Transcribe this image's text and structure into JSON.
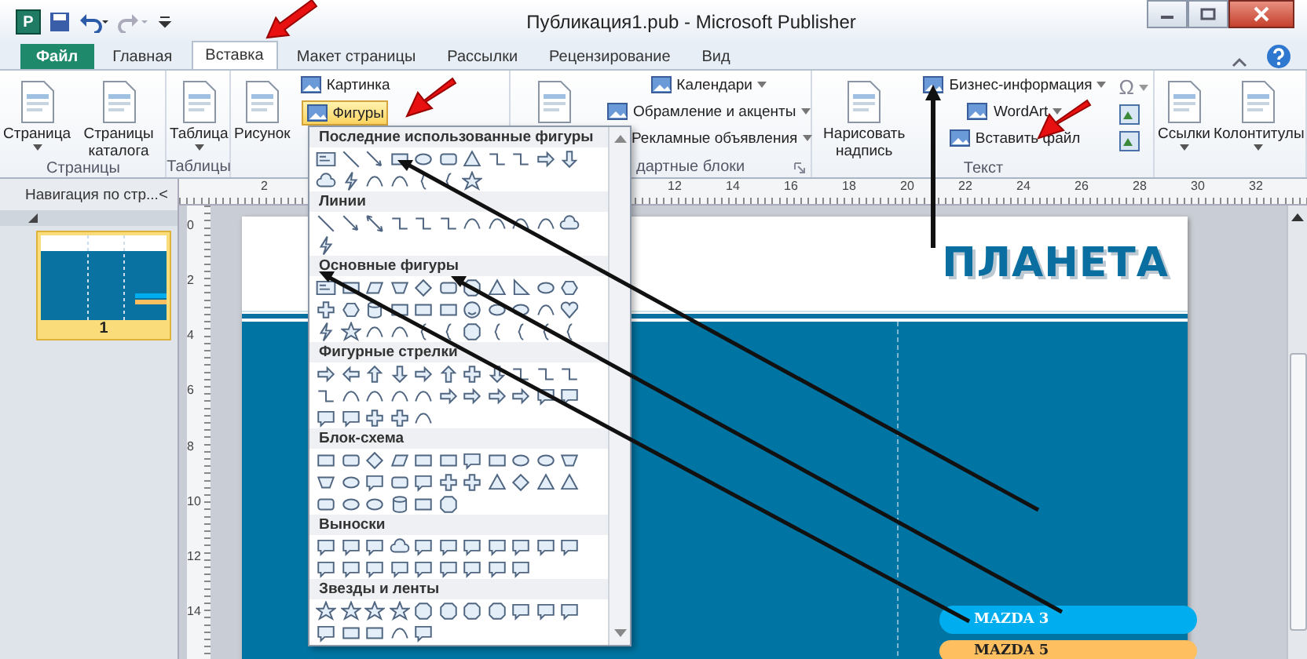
{
  "window": {
    "title": "Публикация1.pub - Microsoft Publisher",
    "app_logo": "P"
  },
  "tabs": [
    {
      "label": "Файл",
      "kind": "file",
      "selected": false
    },
    {
      "label": "Главная",
      "kind": "tab",
      "selected": false
    },
    {
      "label": "Вставка",
      "kind": "tab",
      "selected": true
    },
    {
      "label": "Макет страницы",
      "kind": "tab",
      "selected": false
    },
    {
      "label": "Рассылки",
      "kind": "tab",
      "selected": false
    },
    {
      "label": "Рецензирование",
      "kind": "tab",
      "selected": false
    },
    {
      "label": "Вид",
      "kind": "tab",
      "selected": false
    }
  ],
  "ribbon": {
    "groups": [
      {
        "label": "Страницы",
        "items": [
          {
            "kind": "large",
            "label": "Страница",
            "dropdown": true
          },
          {
            "kind": "large",
            "label": "Страницы каталога"
          }
        ]
      },
      {
        "label": "Таблицы",
        "items": [
          {
            "kind": "large",
            "label": "Таблица",
            "dropdown": true
          }
        ]
      },
      {
        "items": [
          {
            "kind": "large",
            "label": "Рисунок"
          },
          {
            "kind": "small",
            "label": "Картинка",
            "active": false
          },
          {
            "kind": "small",
            "label": "Фигуры",
            "active": true
          }
        ]
      },
      {
        "label": "дартные блоки",
        "launcher": true,
        "items": [
          {
            "kind": "large"
          },
          {
            "kind": "small",
            "label": "Календари",
            "dropdown": true,
            "active": false
          },
          {
            "kind": "small",
            "label": "Обрамление и акценты",
            "dropdown": true,
            "active": false
          },
          {
            "kind": "small",
            "label": "Рекламные объявления",
            "dropdown": true,
            "active": false
          }
        ]
      },
      {
        "label": "Текст",
        "items": [
          {
            "kind": "large",
            "label": "Нарисовать надпись"
          },
          {
            "kind": "small",
            "label": "Бизнес-информация",
            "dropdown": true,
            "active": false
          },
          {
            "kind": "small",
            "label": "WordArt",
            "dropdown": true,
            "active": false
          },
          {
            "kind": "small",
            "label": "Вставить файл",
            "active": false
          },
          {
            "kind": "icon",
            "label": "Ω",
            "dropdown": true
          },
          {
            "kind": "icon"
          },
          {
            "kind": "icon"
          }
        ]
      },
      {
        "items": [
          {
            "kind": "large",
            "label": "Ссылки",
            "dropdown": true
          },
          {
            "kind": "large",
            "label": "Колонтитулы",
            "dropdown": true
          }
        ]
      }
    ]
  },
  "shapes_menu": {
    "sections": [
      {
        "title": "Последние использованные фигуры"
      },
      {
        "title": "Линии"
      },
      {
        "title": "Основные фигуры"
      },
      {
        "title": "Фигурные стрелки"
      },
      {
        "title": "Блок-схема"
      },
      {
        "title": "Выноски"
      },
      {
        "title": "Звезды и ленты"
      }
    ]
  },
  "navigation": {
    "title": "Навигация по стр...",
    "collapse": "<",
    "pages": [
      {
        "label": "1",
        "selected": true
      }
    ]
  },
  "rulers": {
    "horizontal": [
      "2",
      "12",
      "14",
      "16",
      "18",
      "20",
      "22",
      "24",
      "26",
      "28",
      "30",
      "32"
    ],
    "vertical": [
      "0",
      "2",
      "4",
      "6",
      "8",
      "10",
      "12",
      "14"
    ]
  },
  "page": {
    "heading": "ПЛАНЕТА",
    "models": [
      {
        "label": "MAZDA 3",
        "color": "#00aeef"
      },
      {
        "label": "MAZDA 5",
        "color": "#fdbf5f"
      }
    ]
  }
}
